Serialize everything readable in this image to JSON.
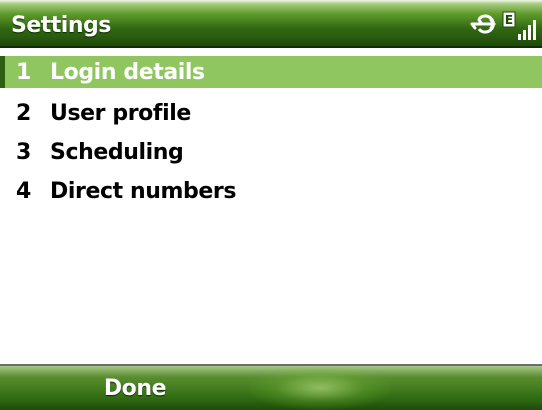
{
  "title_bar": {
    "title": "Settings",
    "icons": [
      "connection-icon",
      "edge-data-icon",
      "signal-strength-icon"
    ],
    "data_indicator": "E"
  },
  "menu": {
    "items": [
      {
        "number": "1",
        "label": "Login details",
        "selected": true
      },
      {
        "number": "2",
        "label": "User profile",
        "selected": false
      },
      {
        "number": "3",
        "label": "Scheduling",
        "selected": false
      },
      {
        "number": "4",
        "label": "Direct numbers",
        "selected": false
      }
    ]
  },
  "softkeys": {
    "left_label": "Done",
    "right_label": ""
  },
  "colors": {
    "title_bar_green": "#316812",
    "selection_green": "#8fc65f",
    "text": "#000000",
    "background": "#ffffff"
  }
}
